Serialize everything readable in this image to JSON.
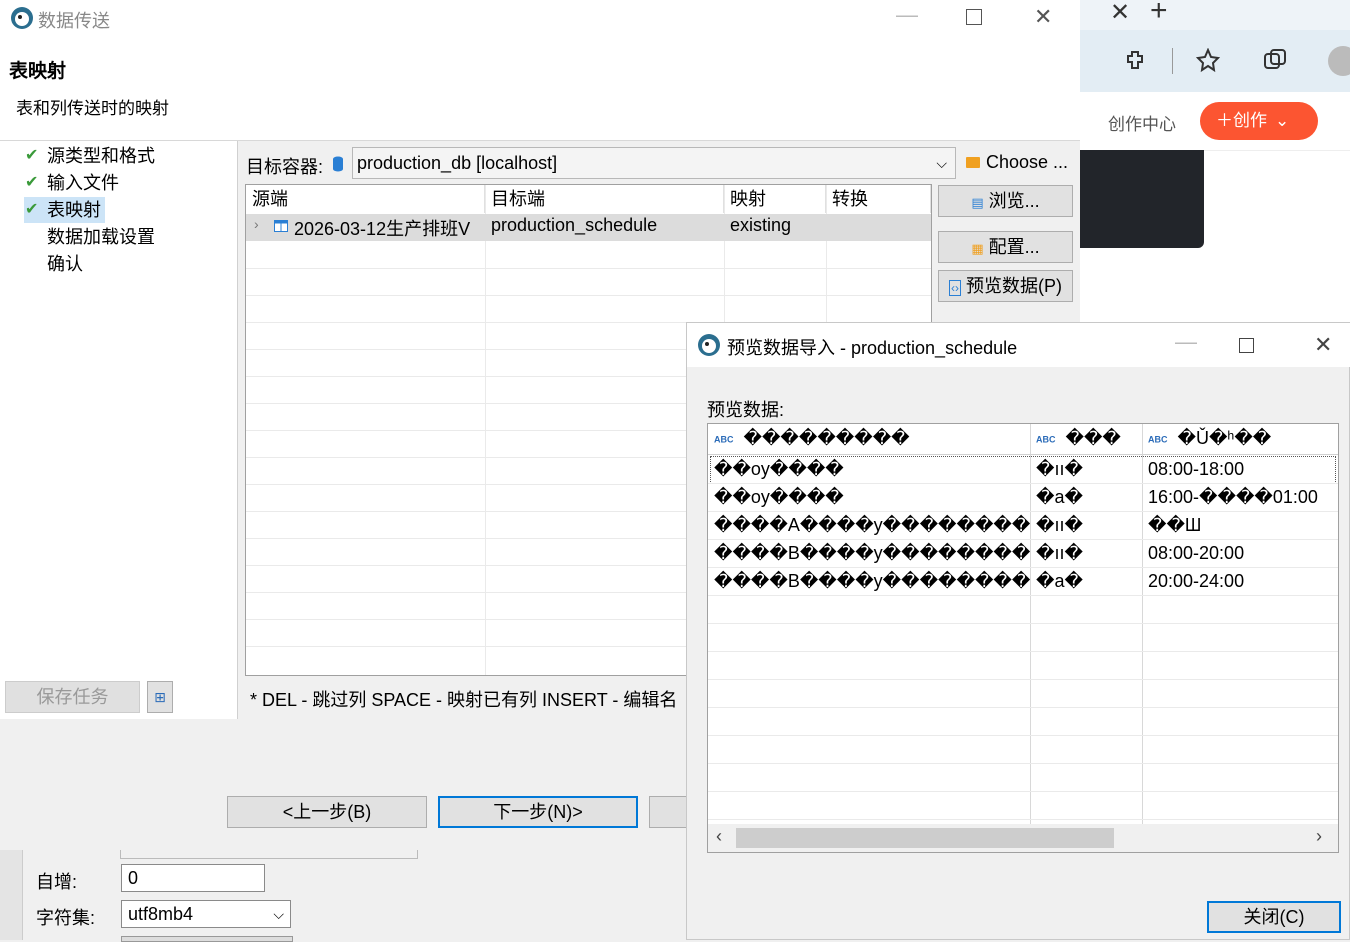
{
  "background_app": {
    "creator_center_label": "创作中心",
    "create_button_label": "创作"
  },
  "main_window": {
    "title": "数据传送",
    "header_title": "表映射",
    "header_subtitle": "表和列传送时的映射",
    "nav_items": [
      {
        "label": "源类型和格式",
        "checked": true
      },
      {
        "label": "输入文件",
        "checked": true
      },
      {
        "label": "表映射",
        "checked": true,
        "selected": true
      },
      {
        "label": "数据加载设置",
        "checked": false
      },
      {
        "label": "确认",
        "checked": false
      }
    ],
    "save_task_label": "保存任务",
    "target_container_label": "目标容器:",
    "target_container_value": "production_db  [localhost]",
    "choose_label": "Choose ...",
    "columns": [
      "源端",
      "目标端",
      "映射",
      "转换"
    ],
    "rows": [
      {
        "source": "2026-03-12生产排班V",
        "target": "production_schedule",
        "mapping": "existing",
        "transform": ""
      }
    ],
    "side_buttons": {
      "browse": "浏览...",
      "configure": "配置...",
      "preview": "预览数据(P)"
    },
    "hint_text": "* DEL - 跳过列  SPACE - 映射已有列  INSERT - 编辑名",
    "back_button": "<上一步(B)",
    "next_button": "下一步(N)>"
  },
  "behind_form": {
    "autoincrement_label": "自增:",
    "autoincrement_value": "0",
    "charset_label": "字符集:",
    "charset_value": "utf8mb4"
  },
  "preview_window": {
    "title": "预览数据导入 - production_schedule",
    "section_label": "预览数据:",
    "column_type_badge": "ABC",
    "columns": [
      "���������",
      "���",
      "�Ǔ�ʰ��"
    ],
    "rows": [
      [
        "��oy����",
        "�ıı�",
        "08:00-18:00"
      ],
      [
        "��oy����",
        "�a�",
        "16:00-����01:00"
      ],
      [
        "����A����y��������",
        "�ıı�",
        "��Ш"
      ],
      [
        "����B����y��������",
        "�ıı�",
        "08:00-20:00"
      ],
      [
        "����B����y��������",
        "�a�",
        "20:00-24:00"
      ]
    ],
    "close_button": "关闭(C)"
  }
}
